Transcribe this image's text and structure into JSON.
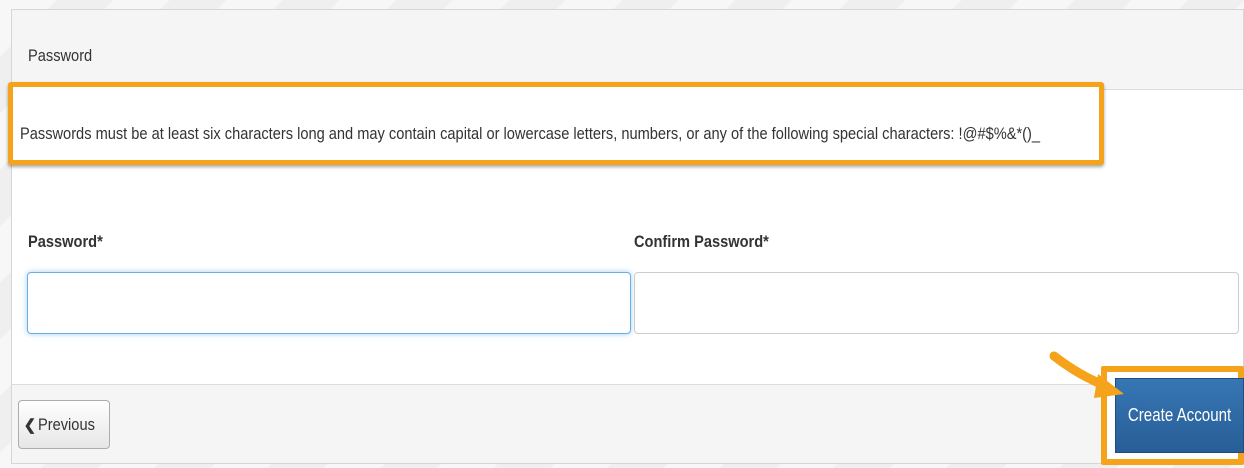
{
  "panel": {
    "title": "Password"
  },
  "notice": {
    "text": "Passwords must be at least six characters long and may contain capital or lowercase letters, numbers, or any of the following special characters: !@#$%&*()_"
  },
  "form": {
    "password_label": "Password*",
    "password_value": "",
    "confirm_label": "Confirm Password*",
    "confirm_value": ""
  },
  "footer": {
    "previous_label": "Previous",
    "previous_icon": "chevron-left-icon",
    "create_label": "Create Account"
  },
  "colors": {
    "highlight": "#f5a31a",
    "primary_button": "#2f6da8",
    "focus_border": "#66afe9"
  }
}
